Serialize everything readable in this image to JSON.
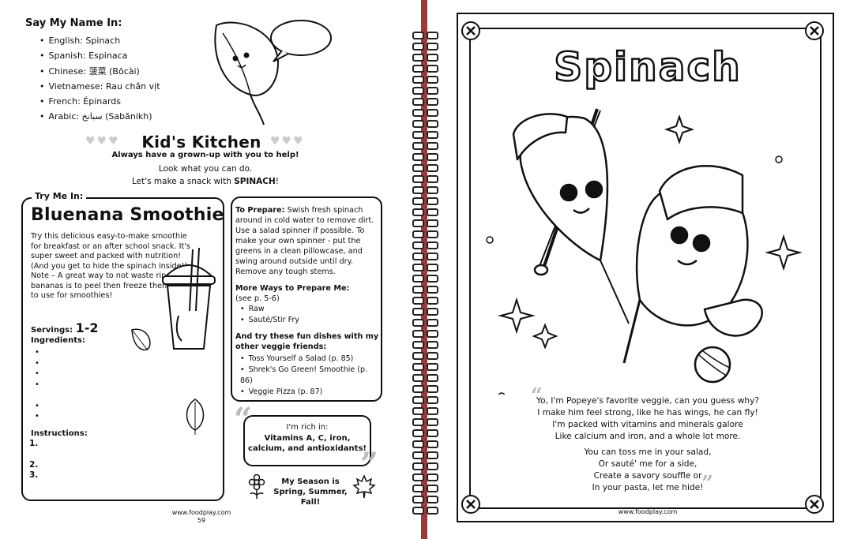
{
  "left_page": {
    "say_name": {
      "heading": "Say My Name In:",
      "languages": [
        "English:  Spinach",
        "Spanish:  Espinaca",
        "Chinese:  菠菜 (Bōcài)",
        "Vietnamese:  Rau chân vịt",
        "French:  Épinards",
        "Arabic:  سبانخ (Sabānikh)"
      ]
    },
    "kids_kitchen": {
      "title": "Kid's Kitchen",
      "subtitle": "Always have a grown-up with you to help!",
      "line1": "Look what you can do.",
      "line2_prefix": "Let's make a snack with ",
      "line2_bold": "SPINACH",
      "line2_suffix": "!"
    },
    "recipe": {
      "try_label": "Try Me In:",
      "title": "Bluenana Smoothie",
      "description": "Try this delicious easy-to-make smoothie for breakfast or an after school snack. It's super sweet and packed with nutrition! (And you get to hide the spinach inside!). Note – A great way to not waste ripe bananas is to peel then freeze them, ready to use for smoothies!",
      "servings_label": "Servings:",
      "servings_value": "1-2",
      "ingredients_label": "Ingredients:",
      "instructions_label": "Instructions:",
      "steps": [
        "1.",
        "2.",
        "3."
      ]
    },
    "prepare": {
      "label": "To Prepare:",
      "text": " Swish fresh spinach around in cold water to remove dirt. Use a salad spinner if possible. To make your own spinner - put the greens in a clean pillowcase, and swing around outside until dry. Remove any tough stems.",
      "more_ways_heading": "More Ways to Prepare Me:",
      "more_ways_ref": "(see p. 5-6)",
      "more_ways": [
        "Raw",
        "Sauté/Stir Fry"
      ],
      "fun_heading_line1": "And try these fun dishes with my",
      "fun_heading_line2": "other veggie friends:",
      "fun_dishes": [
        "Toss Yourself a Salad (p. 85)",
        "Shrek's Go Green! Smoothie (p. 86)",
        "Veggie Pizza (p. 87)"
      ]
    },
    "rich_in": {
      "line1": "I'm rich in:",
      "line2": "Vitamins A, C, iron,",
      "line3": "calcium, and antioxidants!"
    },
    "season": {
      "line1": "My Season is",
      "line2": "Spring, Summer, Fall!"
    },
    "footer_url": "www.foodplay.com",
    "page_number": "59"
  },
  "right_page": {
    "title": "Spinach",
    "poem_stanza1": [
      "Yo, I'm Popeye's favorite veggie, can you guess why?",
      "I make him feel strong, like he has wings, he can fly!",
      "I'm packed with vitamins and minerals galore",
      "Like calcium and iron, and a whole lot more."
    ],
    "poem_stanza2": [
      "You can toss me in your salad,",
      "Or sauté' me for a side,",
      "Create a savory souffle or",
      "In your pasta, let me hide!"
    ],
    "footer_url": "www.foodplay.com"
  },
  "colors": {
    "spine": "#9a3b3b",
    "ink": "#111111",
    "heart_gray": "#cccccc",
    "quote_gray": "#bbbbbb"
  },
  "icons": [
    "spinach-leaf-icon",
    "speech-bubble-icon",
    "heart-icon",
    "smoothie-cup-icon",
    "flower-icon",
    "maple-leaf-icon",
    "close-x-icon",
    "sparkle-icon",
    "baseball-icon"
  ]
}
